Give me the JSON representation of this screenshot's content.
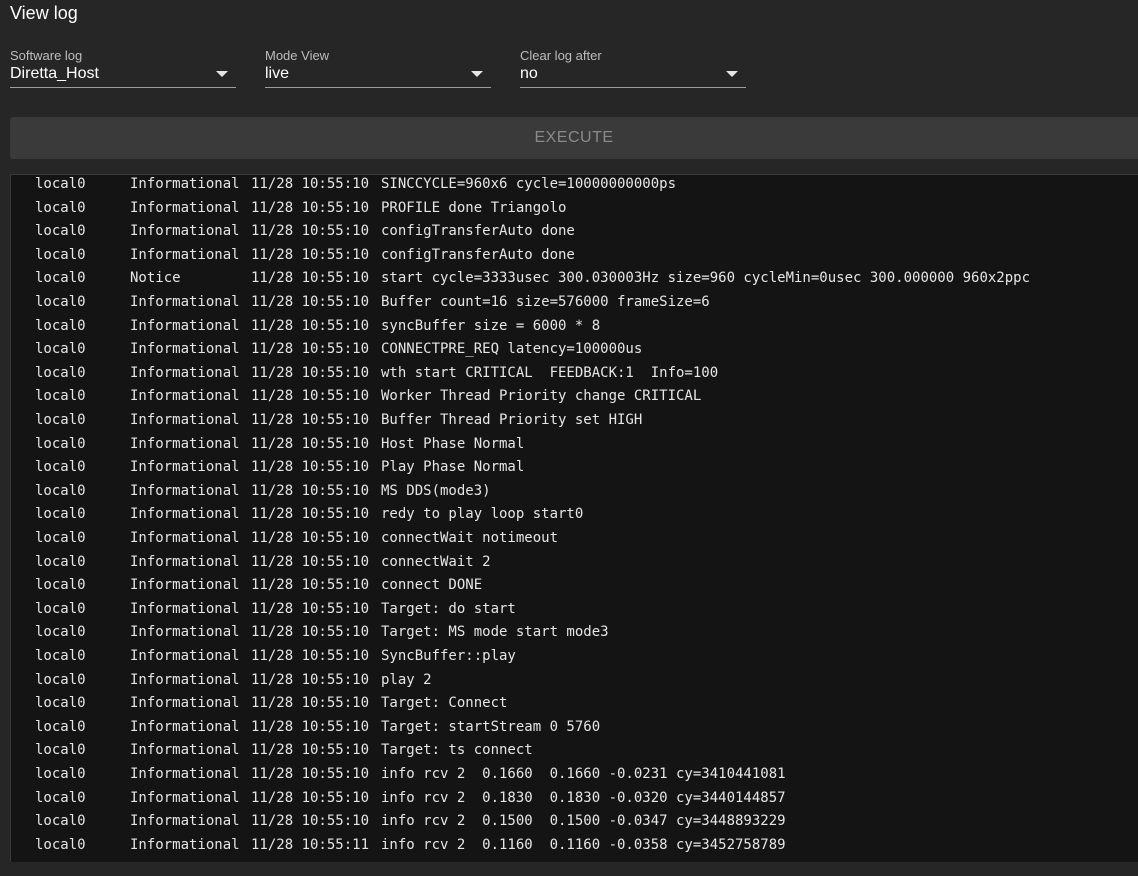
{
  "header": {
    "title": "View log"
  },
  "controls": {
    "software_log": {
      "label": "Software log",
      "value": "Diretta_Host"
    },
    "mode_view": {
      "label": "Mode View",
      "value": "live"
    },
    "clear_log_after": {
      "label": "Clear log after",
      "value": "no"
    },
    "execute_label": "EXECUTE"
  },
  "log": {
    "rows": [
      {
        "facility": "local0",
        "severity": "Informational",
        "timestamp": "11/28 10:55:10",
        "message": "SINCCYCLE=960x6 cycle=10000000000ps"
      },
      {
        "facility": "local0",
        "severity": "Informational",
        "timestamp": "11/28 10:55:10",
        "message": "PROFILE done Triangolo"
      },
      {
        "facility": "local0",
        "severity": "Informational",
        "timestamp": "11/28 10:55:10",
        "message": "configTransferAuto done"
      },
      {
        "facility": "local0",
        "severity": "Informational",
        "timestamp": "11/28 10:55:10",
        "message": "configTransferAuto done"
      },
      {
        "facility": "local0",
        "severity": "Notice",
        "timestamp": "11/28 10:55:10",
        "message": "start cycle=3333usec 300.030003Hz size=960 cycleMin=0usec 300.000000 960x2ppc"
      },
      {
        "facility": "local0",
        "severity": "Informational",
        "timestamp": "11/28 10:55:10",
        "message": "Buffer count=16 size=576000 frameSize=6"
      },
      {
        "facility": "local0",
        "severity": "Informational",
        "timestamp": "11/28 10:55:10",
        "message": "syncBuffer size = 6000 * 8"
      },
      {
        "facility": "local0",
        "severity": "Informational",
        "timestamp": "11/28 10:55:10",
        "message": "CONNECTPRE_REQ latency=100000us"
      },
      {
        "facility": "local0",
        "severity": "Informational",
        "timestamp": "11/28 10:55:10",
        "message": "wth start CRITICAL  FEEDBACK:1  Info=100"
      },
      {
        "facility": "local0",
        "severity": "Informational",
        "timestamp": "11/28 10:55:10",
        "message": "Worker Thread Priority change CRITICAL"
      },
      {
        "facility": "local0",
        "severity": "Informational",
        "timestamp": "11/28 10:55:10",
        "message": "Buffer Thread Priority set HIGH"
      },
      {
        "facility": "local0",
        "severity": "Informational",
        "timestamp": "11/28 10:55:10",
        "message": "Host Phase Normal"
      },
      {
        "facility": "local0",
        "severity": "Informational",
        "timestamp": "11/28 10:55:10",
        "message": "Play Phase Normal"
      },
      {
        "facility": "local0",
        "severity": "Informational",
        "timestamp": "11/28 10:55:10",
        "message": "MS DDS(mode3)"
      },
      {
        "facility": "local0",
        "severity": "Informational",
        "timestamp": "11/28 10:55:10",
        "message": "redy to play loop start0"
      },
      {
        "facility": "local0",
        "severity": "Informational",
        "timestamp": "11/28 10:55:10",
        "message": "connectWait notimeout"
      },
      {
        "facility": "local0",
        "severity": "Informational",
        "timestamp": "11/28 10:55:10",
        "message": "connectWait 2"
      },
      {
        "facility": "local0",
        "severity": "Informational",
        "timestamp": "11/28 10:55:10",
        "message": "connect DONE"
      },
      {
        "facility": "local0",
        "severity": "Informational",
        "timestamp": "11/28 10:55:10",
        "message": "Target: do start"
      },
      {
        "facility": "local0",
        "severity": "Informational",
        "timestamp": "11/28 10:55:10",
        "message": "Target: MS mode start mode3"
      },
      {
        "facility": "local0",
        "severity": "Informational",
        "timestamp": "11/28 10:55:10",
        "message": "SyncBuffer::play"
      },
      {
        "facility": "local0",
        "severity": "Informational",
        "timestamp": "11/28 10:55:10",
        "message": "play 2"
      },
      {
        "facility": "local0",
        "severity": "Informational",
        "timestamp": "11/28 10:55:10",
        "message": "Target: Connect"
      },
      {
        "facility": "local0",
        "severity": "Informational",
        "timestamp": "11/28 10:55:10",
        "message": "Target: startStream 0 5760"
      },
      {
        "facility": "local0",
        "severity": "Informational",
        "timestamp": "11/28 10:55:10",
        "message": "Target: ts connect"
      },
      {
        "facility": "local0",
        "severity": "Informational",
        "timestamp": "11/28 10:55:10",
        "message": "info rcv 2  0.1660  0.1660 -0.0231 cy=3410441081"
      },
      {
        "facility": "local0",
        "severity": "Informational",
        "timestamp": "11/28 10:55:10",
        "message": "info rcv 2  0.1830  0.1830 -0.0320 cy=3440144857"
      },
      {
        "facility": "local0",
        "severity": "Informational",
        "timestamp": "11/28 10:55:10",
        "message": "info rcv 2  0.1500  0.1500 -0.0347 cy=3448893229"
      },
      {
        "facility": "local0",
        "severity": "Informational",
        "timestamp": "11/28 10:55:11",
        "message": "info rcv 2  0.1160  0.1160 -0.0358 cy=3452758789"
      }
    ]
  }
}
